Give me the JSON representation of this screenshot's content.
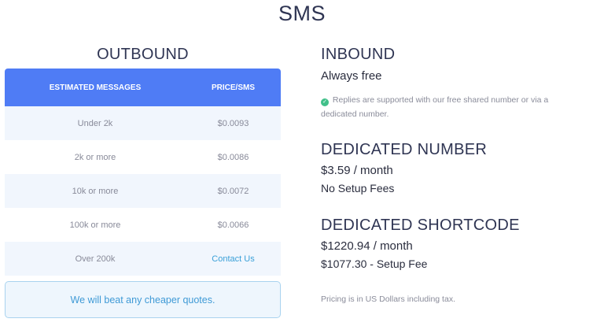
{
  "page": {
    "title": "SMS"
  },
  "outbound": {
    "title": "OUTBOUND",
    "headers": [
      "ESTIMATED MESSAGES",
      "PRICE/SMS"
    ],
    "rows": [
      {
        "messages": "Under 2k",
        "price": "$0.0093"
      },
      {
        "messages": "2k or more",
        "price": "$0.0086"
      },
      {
        "messages": "10k or more",
        "price": "$0.0072"
      },
      {
        "messages": "100k or more",
        "price": "$0.0066"
      },
      {
        "messages": "Over 200k",
        "price": "Contact Us"
      }
    ],
    "quote_text": "We will beat any cheaper quotes."
  },
  "inbound": {
    "title": "INBOUND",
    "subtitle": "Always free",
    "note": "Replies are supported with our free shared number or via a dedicated number."
  },
  "dedicated_number": {
    "title": "DEDICATED NUMBER",
    "price": "$3.59 / month",
    "setup": "No Setup Fees"
  },
  "dedicated_shortcode": {
    "title": "DEDICATED SHORTCODE",
    "price": "$1220.94 / month",
    "setup": "$1077.30 - Setup Fee"
  },
  "footer_note": "Pricing is in US Dollars including tax.",
  "colors": {
    "accent": "#4f7cf5",
    "link": "#3aa0d8",
    "check": "#41c08a"
  },
  "icons": {
    "inbound_note": "check-circle-icon"
  }
}
